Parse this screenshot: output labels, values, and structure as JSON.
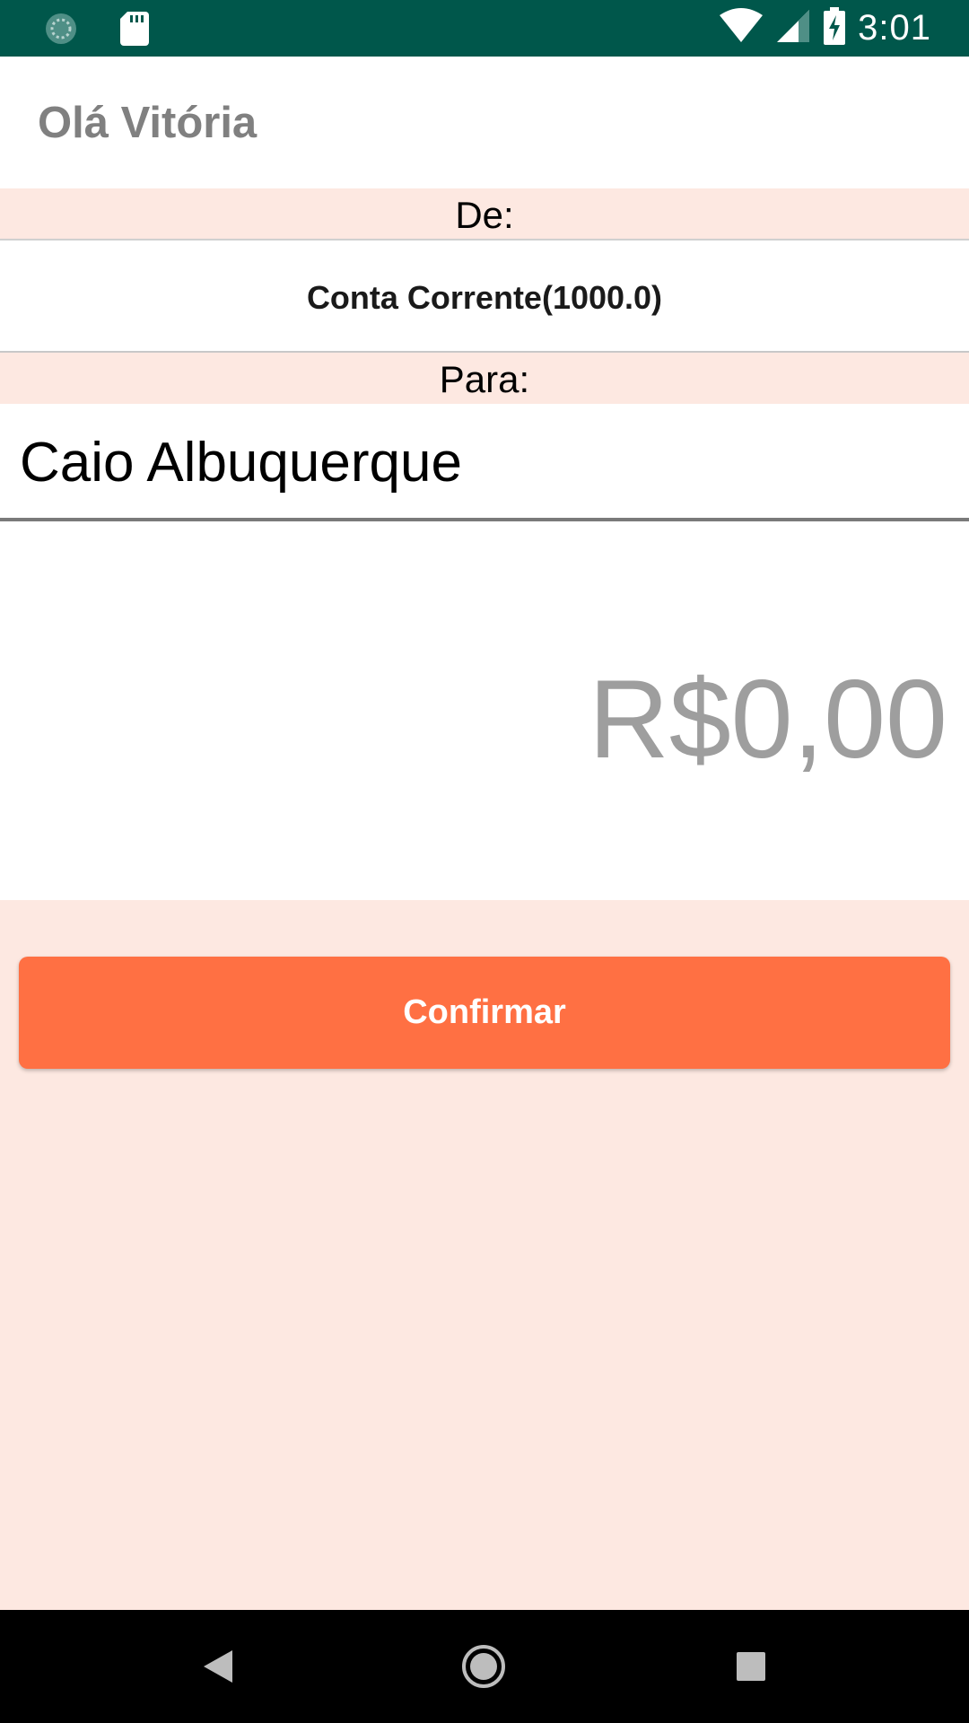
{
  "status_bar": {
    "time": "3:01",
    "icons": [
      "sync-icon",
      "sd-card-icon",
      "wifi-icon",
      "signal-icon",
      "battery-charging-icon"
    ],
    "color": "#00574b"
  },
  "header": {
    "greeting": "Olá Vitória"
  },
  "transfer": {
    "from_label": "De:",
    "from_account": "Conta Corrente(1000.0)",
    "to_label": "Para:",
    "recipient": "Caio Albuquerque",
    "amount": "R$0,00"
  },
  "actions": {
    "confirm_label": "Confirmar",
    "accent": "#ff7043"
  },
  "nav_bar": {
    "icons": [
      "back-icon",
      "home-icon",
      "recents-icon"
    ]
  },
  "colors": {
    "background": "#fde8e1",
    "greeting": "#808080",
    "amount": "#9e9e9e"
  }
}
